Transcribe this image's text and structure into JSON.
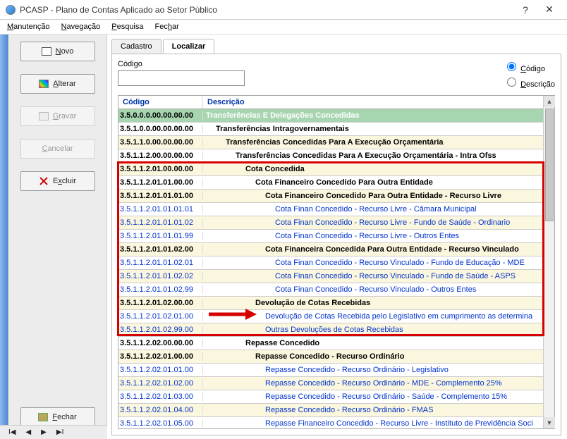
{
  "window": {
    "title": "PCASP - Plano de Contas Aplicado ao Setor Público",
    "help": "?",
    "close": "✕"
  },
  "menu": {
    "manutencao": "Manutenção",
    "navegacao": "Navegação",
    "pesquisa": "Pesquisa",
    "fechar": "Fechar"
  },
  "buttons": {
    "novo": "Novo",
    "alterar": "Alterar",
    "gravar": "Gravar",
    "cancelar": "Cancelar",
    "excluir": "Excluir",
    "fechar": "Fechar"
  },
  "tabs": {
    "cadastro": "Cadastro",
    "localizar": "Localizar"
  },
  "search": {
    "label": "Código",
    "value": ""
  },
  "radios": {
    "codigo": "Código",
    "descricao": "Descrição"
  },
  "columns": {
    "code": "Código",
    "desc": "Descrição"
  },
  "rows": [
    {
      "code": "3.5.0.0.0.00.00.00.00",
      "desc": "Transferências E Delegações Concedidas",
      "style": "header-green bold",
      "indent": 0,
      "link": false,
      "codeLink": false
    },
    {
      "code": "3.5.1.0.0.00.00.00.00",
      "desc": "Transferências Intragovernamentais",
      "style": "white bold",
      "indent": 1,
      "link": false,
      "codeLink": false
    },
    {
      "code": "3.5.1.1.0.00.00.00.00",
      "desc": "Transferências Concedidas Para A Execução Orçamentária",
      "style": "cream bold",
      "indent": 2,
      "link": false,
      "codeLink": false
    },
    {
      "code": "3.5.1.1.2.00.00.00.00",
      "desc": "Transferências Concedidas Para A Execução Orçamentária - Intra Ofss",
      "style": "white bold",
      "indent": 3,
      "link": false,
      "codeLink": false
    },
    {
      "code": "3.5.1.1.2.01.00.00.00",
      "desc": "Cota Concedida",
      "style": "cream bold",
      "indent": 4,
      "link": false,
      "codeLink": false
    },
    {
      "code": "3.5.1.1.2.01.01.00.00",
      "desc": "Cota Financeiro Concedido Para Outra Entidade",
      "style": "white bold",
      "indent": 5,
      "link": false,
      "codeLink": false
    },
    {
      "code": "3.5.1.1.2.01.01.01.00",
      "desc": "Cota Financeiro Concedido Para Outra Entidade - Recurso Livre",
      "style": "cream bold",
      "indent": 6,
      "link": false,
      "codeLink": false
    },
    {
      "code": "3.5.1.1.2.01.01.01.01",
      "desc": "Cota Finan Concedido - Recurso Livre - Câmara Municipal",
      "style": "white",
      "indent": 7,
      "link": true,
      "codeLink": true
    },
    {
      "code": "3.5.1.1.2.01.01.01.02",
      "desc": "Cota Finan Concedido - Recurso Livre - Fundo de Saúde - Ordinario",
      "style": "cream",
      "indent": 7,
      "link": true,
      "codeLink": true
    },
    {
      "code": "3.5.1.1.2.01.01.01.99",
      "desc": "Cota Finan Concedido - Recurso Livre - Outros Entes",
      "style": "white",
      "indent": 7,
      "link": true,
      "codeLink": true
    },
    {
      "code": "3.5.1.1.2.01.01.02.00",
      "desc": "Cota Financeira Concedida Para Outra Entidade - Recurso Vinculado",
      "style": "cream bold",
      "indent": 6,
      "link": false,
      "codeLink": false
    },
    {
      "code": "3.5.1.1.2.01.01.02.01",
      "desc": "Cota Finan Concedido - Recurso Vinculado - Fundo de Educação - MDE",
      "style": "white",
      "indent": 7,
      "link": true,
      "codeLink": true
    },
    {
      "code": "3.5.1.1.2.01.01.02.02",
      "desc": "Cota Finan Concedido - Recurso Vinculado - Fundo de Saúde - ASPS",
      "style": "cream",
      "indent": 7,
      "link": true,
      "codeLink": true
    },
    {
      "code": "3.5.1.1.2.01.01.02.99",
      "desc": "Cota Finan Concedido - Recurso Vinculado - Outros Entes",
      "style": "white",
      "indent": 7,
      "link": true,
      "codeLink": true
    },
    {
      "code": "3.5.1.1.2.01.02.00.00",
      "desc": "Devolução de Cotas Recebidas",
      "style": "cream bold",
      "indent": 5,
      "link": false,
      "codeLink": false
    },
    {
      "code": "3.5.1.1.2.01.02.01.00",
      "desc": "Devolução de Cotas Recebida pelo Legislativo em cumprimento as determina",
      "style": "white",
      "indent": 6,
      "link": true,
      "codeLink": true
    },
    {
      "code": "3.5.1.1.2.01.02.99.00",
      "desc": "Outras Devoluções de Cotas Recebidas",
      "style": "cream",
      "indent": 6,
      "link": true,
      "codeLink": true
    },
    {
      "code": "3.5.1.1.2.02.00.00.00",
      "desc": "Repasse Concedido",
      "style": "white bold",
      "indent": 4,
      "link": false,
      "codeLink": false
    },
    {
      "code": "3.5.1.1.2.02.01.00.00",
      "desc": "Repasse Concedido - Recurso Ordinário",
      "style": "cream bold",
      "indent": 5,
      "link": false,
      "codeLink": false
    },
    {
      "code": "3.5.1.1.2.02.01.01.00",
      "desc": "Repasse Concedido - Recurso Ordinário - Legislativo",
      "style": "white",
      "indent": 6,
      "link": true,
      "codeLink": true
    },
    {
      "code": "3.5.1.1.2.02.01.02.00",
      "desc": "Repasse Concedido - Recurso Ordinário - MDE - Complemento 25%",
      "style": "cream",
      "indent": 6,
      "link": true,
      "codeLink": true
    },
    {
      "code": "3.5.1.1.2.02.01.03.00",
      "desc": "Repasse Concedido - Recurso Ordinário - Saúde - Complemento 15%",
      "style": "white",
      "indent": 6,
      "link": true,
      "codeLink": true
    },
    {
      "code": "3.5.1.1.2.02.01.04.00",
      "desc": "Repasse Concedido - Recurso Ordinário - FMAS",
      "style": "cream",
      "indent": 6,
      "link": true,
      "codeLink": true
    },
    {
      "code": "3.5.1.1.2.02.01.05.00",
      "desc": "Repasse Financeiro Concedido - Recurso Livre - Instituto de Previdência Soci",
      "style": "white",
      "indent": 6,
      "link": true,
      "codeLink": true
    }
  ]
}
